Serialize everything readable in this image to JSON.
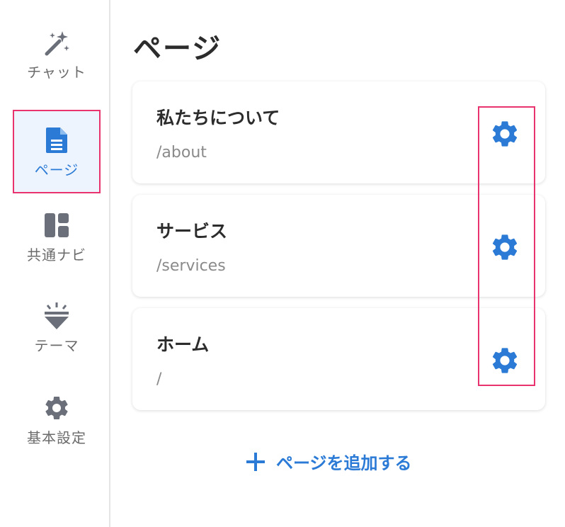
{
  "sidebar": {
    "items": [
      {
        "id": "chat",
        "label": "チャット",
        "icon": "magic-wand-icon",
        "active": false
      },
      {
        "id": "pages",
        "label": "ページ",
        "icon": "document-icon",
        "active": true
      },
      {
        "id": "nav",
        "label": "共通ナビ",
        "icon": "layout-icon",
        "active": false
      },
      {
        "id": "theme",
        "label": "テーマ",
        "icon": "theme-icon",
        "active": false
      },
      {
        "id": "settings",
        "label": "基本設定",
        "icon": "gear-icon",
        "active": false
      }
    ]
  },
  "main": {
    "title": "ページ",
    "pages": [
      {
        "title": "私たちについて",
        "path": "/about"
      },
      {
        "title": "サービス",
        "path": "/services"
      },
      {
        "title": "ホーム",
        "path": "/"
      }
    ],
    "add_label": "ページを追加する"
  },
  "colors": {
    "accent": "#2a7ad6",
    "highlight": "#e8336f",
    "icon_gray": "#6b6f7a",
    "active_bg": "#edf4fd"
  }
}
